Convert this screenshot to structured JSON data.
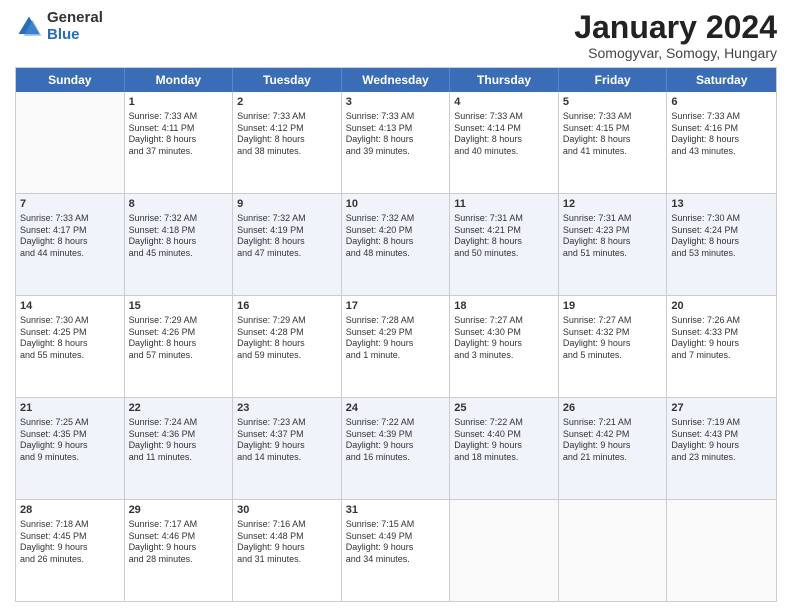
{
  "logo": {
    "general": "General",
    "blue": "Blue"
  },
  "title": "January 2024",
  "subtitle": "Somogyvar, Somogy, Hungary",
  "days": [
    "Sunday",
    "Monday",
    "Tuesday",
    "Wednesday",
    "Thursday",
    "Friday",
    "Saturday"
  ],
  "weeks": [
    [
      {
        "day": "",
        "info": ""
      },
      {
        "day": "1",
        "info": "Sunrise: 7:33 AM\nSunset: 4:11 PM\nDaylight: 8 hours\nand 37 minutes."
      },
      {
        "day": "2",
        "info": "Sunrise: 7:33 AM\nSunset: 4:12 PM\nDaylight: 8 hours\nand 38 minutes."
      },
      {
        "day": "3",
        "info": "Sunrise: 7:33 AM\nSunset: 4:13 PM\nDaylight: 8 hours\nand 39 minutes."
      },
      {
        "day": "4",
        "info": "Sunrise: 7:33 AM\nSunset: 4:14 PM\nDaylight: 8 hours\nand 40 minutes."
      },
      {
        "day": "5",
        "info": "Sunrise: 7:33 AM\nSunset: 4:15 PM\nDaylight: 8 hours\nand 41 minutes."
      },
      {
        "day": "6",
        "info": "Sunrise: 7:33 AM\nSunset: 4:16 PM\nDaylight: 8 hours\nand 43 minutes."
      }
    ],
    [
      {
        "day": "7",
        "info": "Sunrise: 7:33 AM\nSunset: 4:17 PM\nDaylight: 8 hours\nand 44 minutes."
      },
      {
        "day": "8",
        "info": "Sunrise: 7:32 AM\nSunset: 4:18 PM\nDaylight: 8 hours\nand 45 minutes."
      },
      {
        "day": "9",
        "info": "Sunrise: 7:32 AM\nSunset: 4:19 PM\nDaylight: 8 hours\nand 47 minutes."
      },
      {
        "day": "10",
        "info": "Sunrise: 7:32 AM\nSunset: 4:20 PM\nDaylight: 8 hours\nand 48 minutes."
      },
      {
        "day": "11",
        "info": "Sunrise: 7:31 AM\nSunset: 4:21 PM\nDaylight: 8 hours\nand 50 minutes."
      },
      {
        "day": "12",
        "info": "Sunrise: 7:31 AM\nSunset: 4:23 PM\nDaylight: 8 hours\nand 51 minutes."
      },
      {
        "day": "13",
        "info": "Sunrise: 7:30 AM\nSunset: 4:24 PM\nDaylight: 8 hours\nand 53 minutes."
      }
    ],
    [
      {
        "day": "14",
        "info": "Sunrise: 7:30 AM\nSunset: 4:25 PM\nDaylight: 8 hours\nand 55 minutes."
      },
      {
        "day": "15",
        "info": "Sunrise: 7:29 AM\nSunset: 4:26 PM\nDaylight: 8 hours\nand 57 minutes."
      },
      {
        "day": "16",
        "info": "Sunrise: 7:29 AM\nSunset: 4:28 PM\nDaylight: 8 hours\nand 59 minutes."
      },
      {
        "day": "17",
        "info": "Sunrise: 7:28 AM\nSunset: 4:29 PM\nDaylight: 9 hours\nand 1 minute."
      },
      {
        "day": "18",
        "info": "Sunrise: 7:27 AM\nSunset: 4:30 PM\nDaylight: 9 hours\nand 3 minutes."
      },
      {
        "day": "19",
        "info": "Sunrise: 7:27 AM\nSunset: 4:32 PM\nDaylight: 9 hours\nand 5 minutes."
      },
      {
        "day": "20",
        "info": "Sunrise: 7:26 AM\nSunset: 4:33 PM\nDaylight: 9 hours\nand 7 minutes."
      }
    ],
    [
      {
        "day": "21",
        "info": "Sunrise: 7:25 AM\nSunset: 4:35 PM\nDaylight: 9 hours\nand 9 minutes."
      },
      {
        "day": "22",
        "info": "Sunrise: 7:24 AM\nSunset: 4:36 PM\nDaylight: 9 hours\nand 11 minutes."
      },
      {
        "day": "23",
        "info": "Sunrise: 7:23 AM\nSunset: 4:37 PM\nDaylight: 9 hours\nand 14 minutes."
      },
      {
        "day": "24",
        "info": "Sunrise: 7:22 AM\nSunset: 4:39 PM\nDaylight: 9 hours\nand 16 minutes."
      },
      {
        "day": "25",
        "info": "Sunrise: 7:22 AM\nSunset: 4:40 PM\nDaylight: 9 hours\nand 18 minutes."
      },
      {
        "day": "26",
        "info": "Sunrise: 7:21 AM\nSunset: 4:42 PM\nDaylight: 9 hours\nand 21 minutes."
      },
      {
        "day": "27",
        "info": "Sunrise: 7:19 AM\nSunset: 4:43 PM\nDaylight: 9 hours\nand 23 minutes."
      }
    ],
    [
      {
        "day": "28",
        "info": "Sunrise: 7:18 AM\nSunset: 4:45 PM\nDaylight: 9 hours\nand 26 minutes."
      },
      {
        "day": "29",
        "info": "Sunrise: 7:17 AM\nSunset: 4:46 PM\nDaylight: 9 hours\nand 28 minutes."
      },
      {
        "day": "30",
        "info": "Sunrise: 7:16 AM\nSunset: 4:48 PM\nDaylight: 9 hours\nand 31 minutes."
      },
      {
        "day": "31",
        "info": "Sunrise: 7:15 AM\nSunset: 4:49 PM\nDaylight: 9 hours\nand 34 minutes."
      },
      {
        "day": "",
        "info": ""
      },
      {
        "day": "",
        "info": ""
      },
      {
        "day": "",
        "info": ""
      }
    ]
  ]
}
